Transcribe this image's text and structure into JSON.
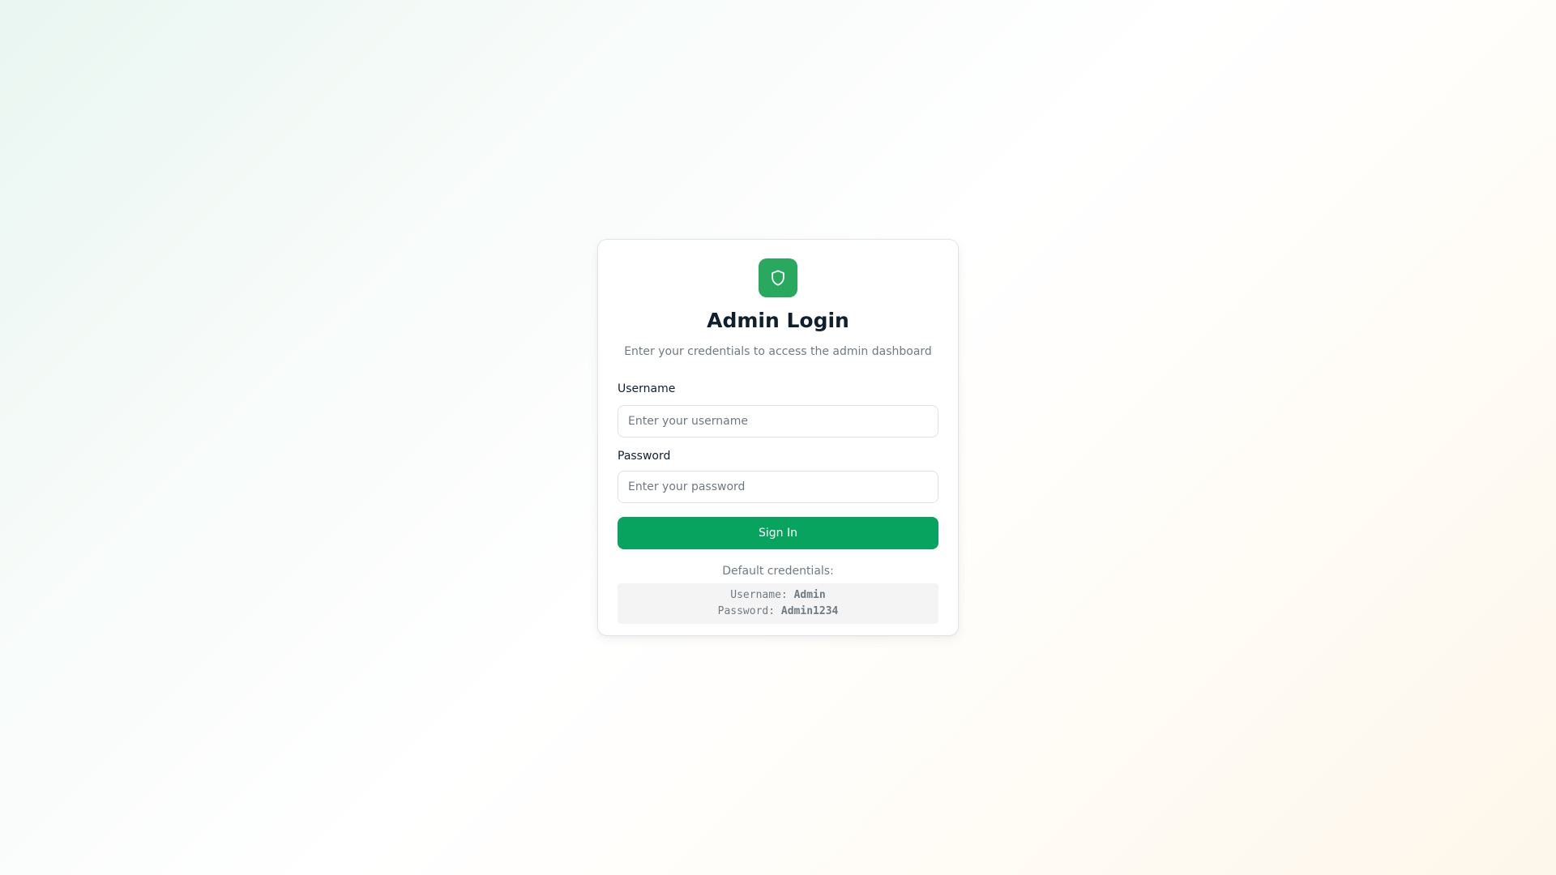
{
  "login": {
    "title": "Admin Login",
    "subtitle": "Enter your credentials to access the admin dashboard",
    "icon": "shield-icon",
    "username_label": "Username",
    "username_placeholder": "Enter your username",
    "password_label": "Password",
    "password_placeholder": "Enter your password",
    "submit_label": "Sign In"
  },
  "defaults": {
    "title": "Default credentials:",
    "username_label": "Username:",
    "username_value": "Admin",
    "password_label": "Password:",
    "password_value": "Admin1234"
  },
  "colors": {
    "accent": "#07a35f",
    "icon_bg": "#29a860",
    "title_text": "#0f1f2e",
    "muted_text": "#707a80"
  }
}
